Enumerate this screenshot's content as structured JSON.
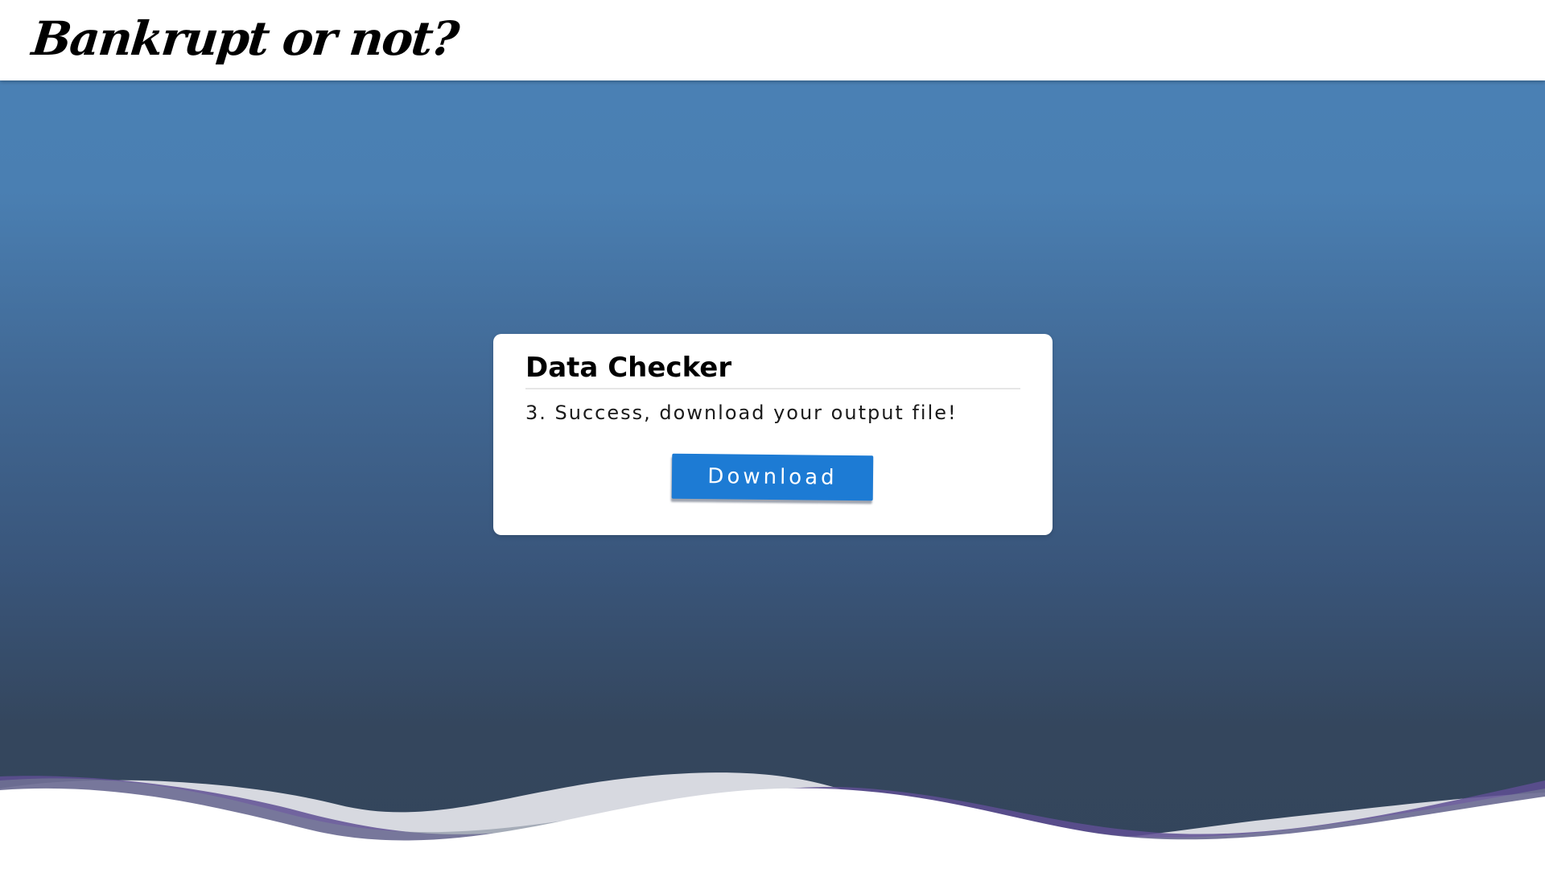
{
  "header": {
    "brand": "Bankrupt or not?"
  },
  "card": {
    "title": "Data Checker",
    "message": "3. Success, download your output file!",
    "button_label": "Download"
  },
  "colors": {
    "hero_top": "#4a80b4",
    "hero_bottom": "#33455c",
    "button": "#1d7bd4",
    "wave_purple": "#6b5aa0",
    "wave_gray": "#e6e6ea"
  }
}
